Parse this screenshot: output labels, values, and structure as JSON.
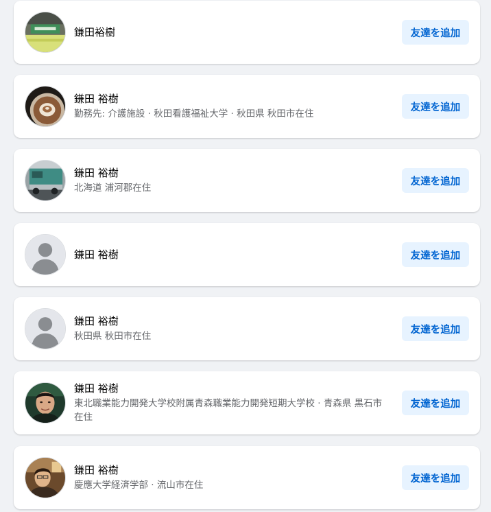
{
  "results": [
    {
      "name": "鎌田裕樹",
      "subtitle": "",
      "avatar": "photo-green-sign",
      "button_label": "友達を追加"
    },
    {
      "name": "鎌田 裕樹",
      "subtitle": "勤務先: 介護施設 · 秋田看護福祉大学 · 秋田県 秋田市在住",
      "avatar": "photo-latte-art",
      "button_label": "友達を追加"
    },
    {
      "name": "鎌田 裕樹",
      "subtitle": "北海道 浦河郡在住",
      "avatar": "photo-green-truck",
      "button_label": "友達を追加"
    },
    {
      "name": "鎌田 裕樹",
      "subtitle": "",
      "avatar": "default-person",
      "button_label": "友達を追加"
    },
    {
      "name": "鎌田 裕樹",
      "subtitle": "秋田県 秋田市在住",
      "avatar": "default-person",
      "button_label": "友達を追加"
    },
    {
      "name": "鎌田 裕樹",
      "subtitle": "東北職業能力開発大学校附属青森職業能力開発短期大学校 · 青森県 黒石市在住",
      "avatar": "photo-man-portrait",
      "button_label": "友達を追加"
    },
    {
      "name": "鎌田 裕樹",
      "subtitle": "慶應大学経済学部 · 流山市在住",
      "avatar": "photo-man-bar",
      "button_label": "友達を追加"
    }
  ],
  "colors": {
    "page_background": "#f0f2f5",
    "card_background": "#ffffff",
    "button_background": "#e7f3ff",
    "button_text": "#0064d1",
    "secondary_text": "#65676b"
  }
}
